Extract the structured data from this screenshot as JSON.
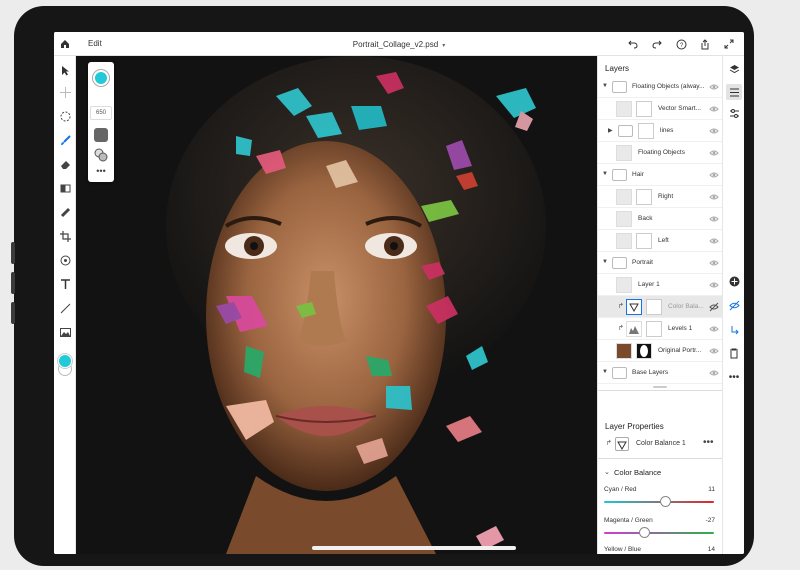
{
  "app": {
    "menu_label": "Edit",
    "document_title": "Portrait_Collage_v2.psd"
  },
  "brush_panel": {
    "size_value": "650",
    "more_label": "•••"
  },
  "layers_panel": {
    "title": "Layers",
    "layers": [
      {
        "label": "Floating Objects (alway...",
        "kind": "group-open"
      },
      {
        "label": "Vector Smart...",
        "kind": "layer"
      },
      {
        "label": "lines",
        "kind": "group-closed"
      },
      {
        "label": "Floating Objects",
        "kind": "layer"
      },
      {
        "label": "Hair",
        "kind": "group-open"
      },
      {
        "label": "Right",
        "kind": "layer"
      },
      {
        "label": "Back",
        "kind": "layer"
      },
      {
        "label": "Left",
        "kind": "layer"
      },
      {
        "label": "Portrait",
        "kind": "group-open"
      },
      {
        "label": "Layer 1",
        "kind": "layer"
      },
      {
        "label": "Color Bala...",
        "kind": "adjustment",
        "selected": true
      },
      {
        "label": "Levels 1",
        "kind": "adjustment"
      },
      {
        "label": "Original Portr...",
        "kind": "layer"
      },
      {
        "label": "Base Layers",
        "kind": "group-open"
      }
    ]
  },
  "layer_properties": {
    "title": "Layer Properties",
    "layer_name": "Color Balance 1",
    "more_label": "•••",
    "section_title": "Color Balance",
    "sliders": [
      {
        "name": "Cyan / Red",
        "value": "11",
        "numeric": 11,
        "color_from": "#1ec8d4",
        "color_to": "#e0262a"
      },
      {
        "name": "Magenta / Green",
        "value": "-27",
        "numeric": -27,
        "color_from": "#d23ad0",
        "color_to": "#2bb24a"
      },
      {
        "name": "Yellow / Blue",
        "value": "14",
        "numeric": 14,
        "color_from": "#e8d418",
        "color_to": "#2a3ad8"
      }
    ]
  },
  "colors": {
    "foreground_swatch": "#22c9d6",
    "canvas_bg": "#121212"
  }
}
